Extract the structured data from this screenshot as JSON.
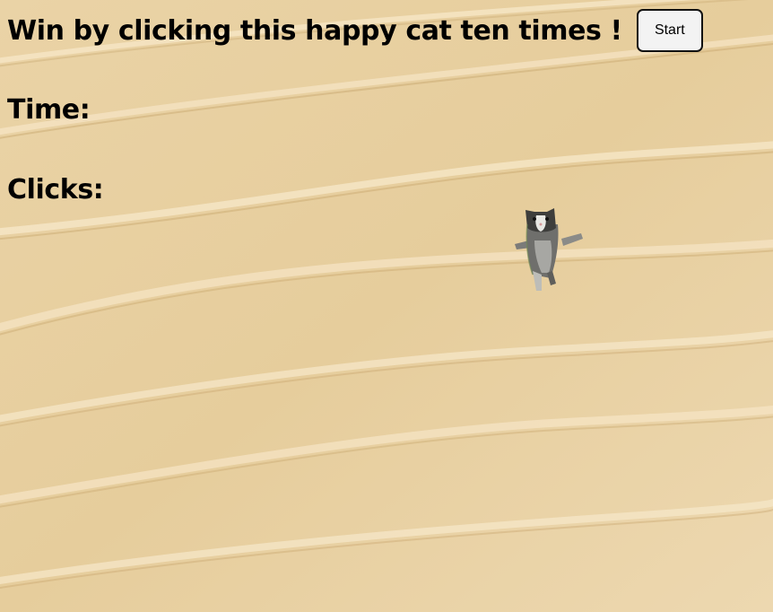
{
  "header": {
    "title": "Win by clicking this happy cat ten times !",
    "start_label": "Start"
  },
  "stats": {
    "time_label": "Time:",
    "time_value": "",
    "clicks_label": "Clicks:",
    "clicks_value": ""
  },
  "target": {
    "icon": "happy-cat-icon"
  },
  "colors": {
    "background": "#e7cfa0",
    "text": "#000000",
    "button_bg": "#f3f3f3"
  }
}
